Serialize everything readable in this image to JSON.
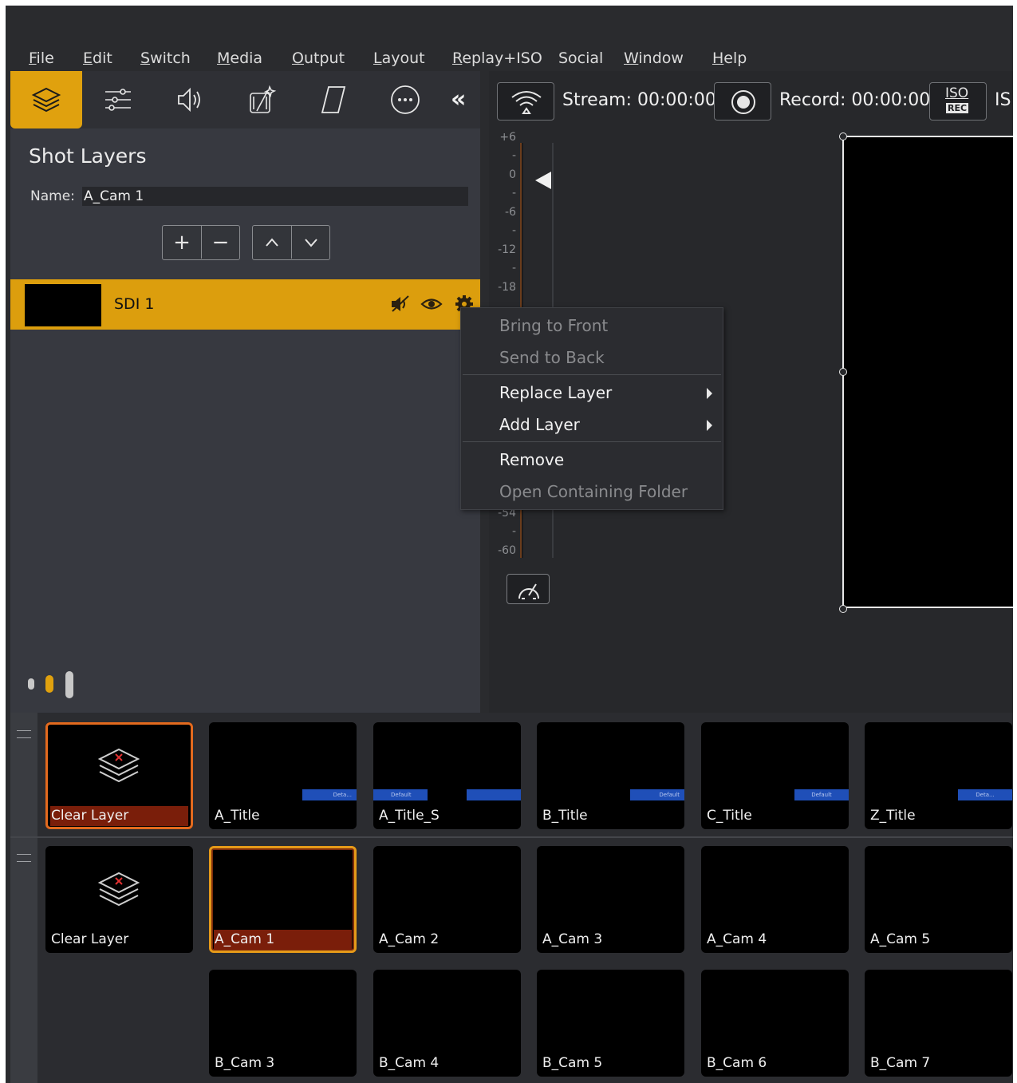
{
  "menu": [
    "File",
    "Edit",
    "Switch",
    "Media",
    "Output",
    "Layout",
    "Replay+ISO",
    "Social",
    "Window",
    "Help"
  ],
  "menu_underline": [
    "F",
    "E",
    "S",
    "M",
    "O",
    "L",
    "R",
    "",
    "W",
    "H"
  ],
  "toolbar": {
    "icons": [
      "layers-icon",
      "sliders-icon",
      "speaker-icon",
      "magic-clapper-icon",
      "parallelogram-icon",
      "more-icon"
    ],
    "collapse": "«"
  },
  "panel": {
    "title": "Shot Layers",
    "name_label": "Name:",
    "name_value": "A_Cam 1",
    "add": "+",
    "remove": "−",
    "up": "^",
    "down": "v"
  },
  "layer": {
    "name": "SDI 1"
  },
  "status": {
    "stream": "Stream: 00:00:00",
    "record": "Record: 00:00:00",
    "iso_top": "ISO",
    "iso_bottom": "REC",
    "iso_txt": "IS"
  },
  "meter_ticks": [
    "+6",
    "-",
    "0",
    "-",
    "-6",
    "-",
    "-12",
    "-",
    "-18",
    "-54",
    "-",
    "-60"
  ],
  "context_menu": {
    "bring_front": "Bring to Front",
    "send_back": "Send to Back",
    "replace": "Replace Layer",
    "add": "Add Layer",
    "remove": "Remove",
    "open_folder": "Open Containing Folder"
  },
  "row1": [
    "Clear Layer",
    "A_Title",
    "A_Title_S",
    "B_Title",
    "C_Title",
    "Z_Title"
  ],
  "row2": [
    "Clear Layer",
    "A_Cam 1",
    "A_Cam 2",
    "A_Cam 3",
    "A_Cam 4",
    "A_Cam 5"
  ],
  "row3": [
    "B_Cam 3",
    "B_Cam 4",
    "B_Cam 5",
    "B_Cam 6",
    "B_Cam 7"
  ],
  "title_bar_text": {
    "deta": "Deta...",
    "default": "Default"
  },
  "colors": {
    "accent": "#dc9e0d",
    "live": "#7a1e0a",
    "selected_border": "#e36a1e"
  }
}
